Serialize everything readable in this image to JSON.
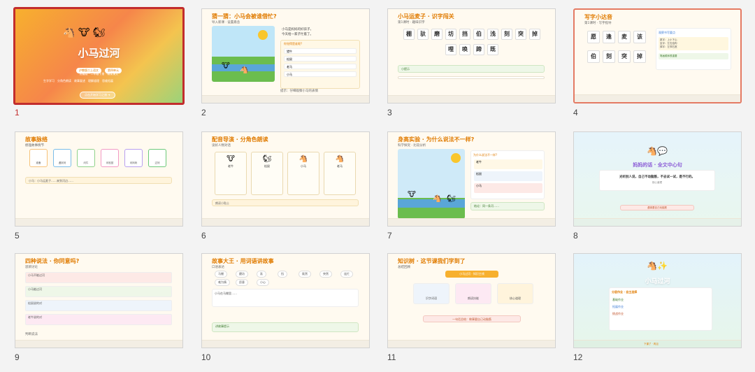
{
  "slides": [
    {
      "num": "1",
      "title": "小马过河",
      "tag1": "沪教版二上语文",
      "tag2": "第四单元",
      "sub": "统编版 · 二年级下册 · 精读课文",
      "features": [
        "生字学习",
        "分角色朗读",
        "故事复述",
        "理解道理",
        "思维拓展"
      ],
      "btn": "点击开始学习之旅 ➜"
    },
    {
      "num": "2",
      "title": "猜一猜：小马会被谁借忙?",
      "sub": "导入新课 · 设置悬念",
      "body1": "小马是妈妈的好孩子，",
      "body2": "今天给一家子忙着了。",
      "quiz": "你觉得是谁呢?",
      "options": [
        "猎牛",
        "松鼠",
        "老马",
        "小马"
      ],
      "foot": "提示：仔细观察小马的表情"
    },
    {
      "num": "3",
      "title": "小马运麦子 · 识字闯关",
      "sub": "第1课时 · 趣味识字",
      "chars1": [
        "棚",
        "驮",
        "磨",
        "坊",
        "挡",
        "伯",
        "浅",
        "刻",
        "突",
        "掉"
      ],
      "chars2": [
        "哩",
        "唤",
        "蹄",
        "既"
      ],
      "tip": "小提示",
      "bottom": "我会读"
    },
    {
      "num": "4",
      "title": "写字小达音",
      "sub": "第1课时 · 写字指导",
      "chars1": [
        "愿",
        "逢",
        "麦",
        "该"
      ],
      "chars2": [
        "伯",
        "刻",
        "突",
        "掉"
      ],
      "side_title": "观察书写要点",
      "side": [
        "愿字：上小下心",
        "坐字：左右结构",
        "掉字：左窄右宽"
      ],
      "tip": "笔画顺序很重要"
    },
    {
      "num": "5",
      "title": "故事脉络",
      "sub": "梳理故事情节",
      "steps": [
        "准备",
        "遇到河",
        "问牛",
        "问松鼠",
        "问妈妈",
        "过河"
      ],
      "bar": "小马：小马运麦子……来到河边……"
    },
    {
      "num": "6",
      "title": "配音导演 · 分角色朗读",
      "sub": "读好人物对话",
      "roles": [
        "老牛",
        "松鼠",
        "小马",
        "老马"
      ],
      "tip": "朗读小贴士"
    },
    {
      "num": "7",
      "title": "身高实验 · 为什么说法不一样?",
      "sub": "科学探究 · 比较分析",
      "q": "为什么说法不一样?",
      "items": [
        "老牛",
        "松鼠",
        "小马"
      ],
      "bottom": "结论：同一条河……"
    },
    {
      "num": "8",
      "title": "妈妈的话 · 全文中心句",
      "quote": "光听别人说，自己不动脑筋，不去试一试，是不行的。",
      "note": "核心道理",
      "ans": "遇事要自己动脑筋"
    },
    {
      "num": "9",
      "title": "四种说法 · 你同意吗?",
      "sub": "思辨讨论",
      "rows": [
        "小马不能过河",
        "小马能过河",
        "松鼠说的对",
        "老牛说的对"
      ],
      "bottom": "判断说法"
    },
    {
      "num": "10",
      "title": "故事大王 · 用词语讲故事",
      "sub": "口语表达",
      "words": [
        "马棚",
        "磨坊",
        "驮",
        "挡",
        "既然",
        "突然",
        "连忙",
        "难为情",
        "愿意",
        "小心"
      ],
      "prompt": "小马在马棚里……",
      "bottom": "讲故事提示"
    },
    {
      "num": "11",
      "title": "知识树 · 这节课我们学到了",
      "sub": "总结回顾",
      "root": "小马过河 · 知识主线",
      "branches": [
        "识字词语",
        "朗读技能",
        "核心道理"
      ],
      "bottom": "一句话总结：做事要自己动脑筋"
    },
    {
      "num": "12",
      "title": "小马过河",
      "hw_title": "分层作业 · 自主选择",
      "hw": [
        "基础作业",
        "拓展作业",
        "挑战作业"
      ],
      "foot": "下课了 · 再见"
    }
  ],
  "colors": {
    "orange": "#e07b00",
    "selected": "#c22d2d",
    "hover": "#e47a63"
  }
}
